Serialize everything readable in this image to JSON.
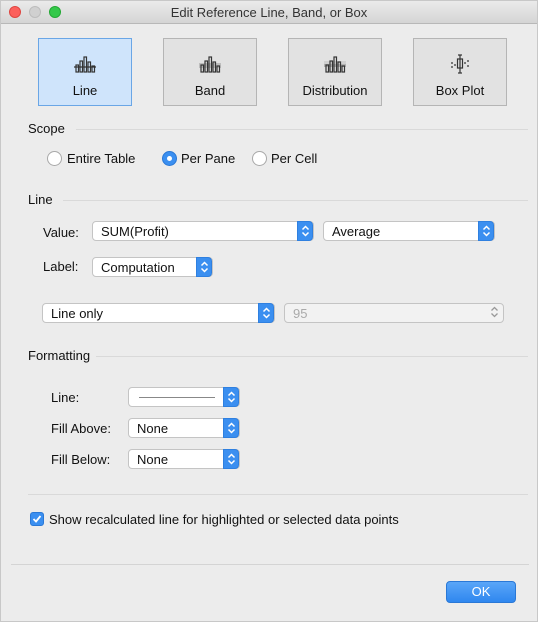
{
  "window": {
    "title": "Edit Reference Line, Band, or Box"
  },
  "types": [
    {
      "label": "Line",
      "icon": "reference-line-icon"
    },
    {
      "label": "Band",
      "icon": "reference-band-icon"
    },
    {
      "label": "Distribution",
      "icon": "distribution-icon"
    },
    {
      "label": "Box Plot",
      "icon": "box-plot-icon"
    }
  ],
  "selected_type": "Line",
  "scope": {
    "heading": "Scope",
    "options": [
      "Entire Table",
      "Per Pane",
      "Per Cell"
    ],
    "selected": "Per Pane"
  },
  "line": {
    "heading": "Line",
    "value_label": "Value:",
    "value_field": "SUM(Profit)",
    "aggregation": "Average",
    "label_label": "Label:",
    "label_value": "Computation",
    "interval_option": "Line only",
    "interval_value": "95"
  },
  "formatting": {
    "heading": "Formatting",
    "line_label": "Line:",
    "fill_above_label": "Fill Above:",
    "fill_above_value": "None",
    "fill_below_label": "Fill Below:",
    "fill_below_value": "None"
  },
  "recalc": {
    "label": "Show recalculated line for highlighted or selected data points",
    "checked": true
  },
  "buttons": {
    "ok": "OK"
  },
  "colors": {
    "accent": "#3b8ff0",
    "selected_tile": "#cfe4fb"
  }
}
